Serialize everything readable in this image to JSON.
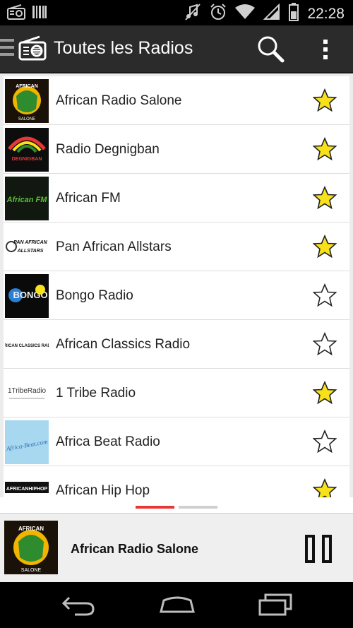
{
  "status_bar": {
    "time": "22:28"
  },
  "action_bar": {
    "title": "Toutes les Radios"
  },
  "stations": [
    {
      "name": "African Radio Salone",
      "favorite": true,
      "logo_text": "AFRICAN",
      "logo_sub": "SALONE"
    },
    {
      "name": "Radio Degnigban",
      "favorite": true,
      "logo_text": "DEGNIGBAN"
    },
    {
      "name": "African FM",
      "favorite": true,
      "logo_text": "African FM"
    },
    {
      "name": "Pan African Allstars",
      "favorite": true,
      "logo_text": "PAN AFRICAN ALLSTARS"
    },
    {
      "name": "Bongo Radio",
      "favorite": false,
      "logo_text": "BONGO"
    },
    {
      "name": "African Classics Radio",
      "favorite": false,
      "logo_text": "AFRICAN CLASSICS RADIO"
    },
    {
      "name": "1 Tribe Radio",
      "favorite": true,
      "logo_text": "1TribeRadio"
    },
    {
      "name": "Africa Beat Radio",
      "favorite": false,
      "logo_text": "Africa-Beat.com"
    },
    {
      "name": "African Hip Hop",
      "favorite": true,
      "logo_text": "AFRICANHIPHOP"
    }
  ],
  "player": {
    "now_playing": "African Radio Salone",
    "logo_text": "AFRICAN",
    "logo_sub": "SALONE"
  },
  "colors": {
    "accent": "#e53935",
    "star_fill": "#f7e11b",
    "action_bar": "#2b2b2b"
  }
}
